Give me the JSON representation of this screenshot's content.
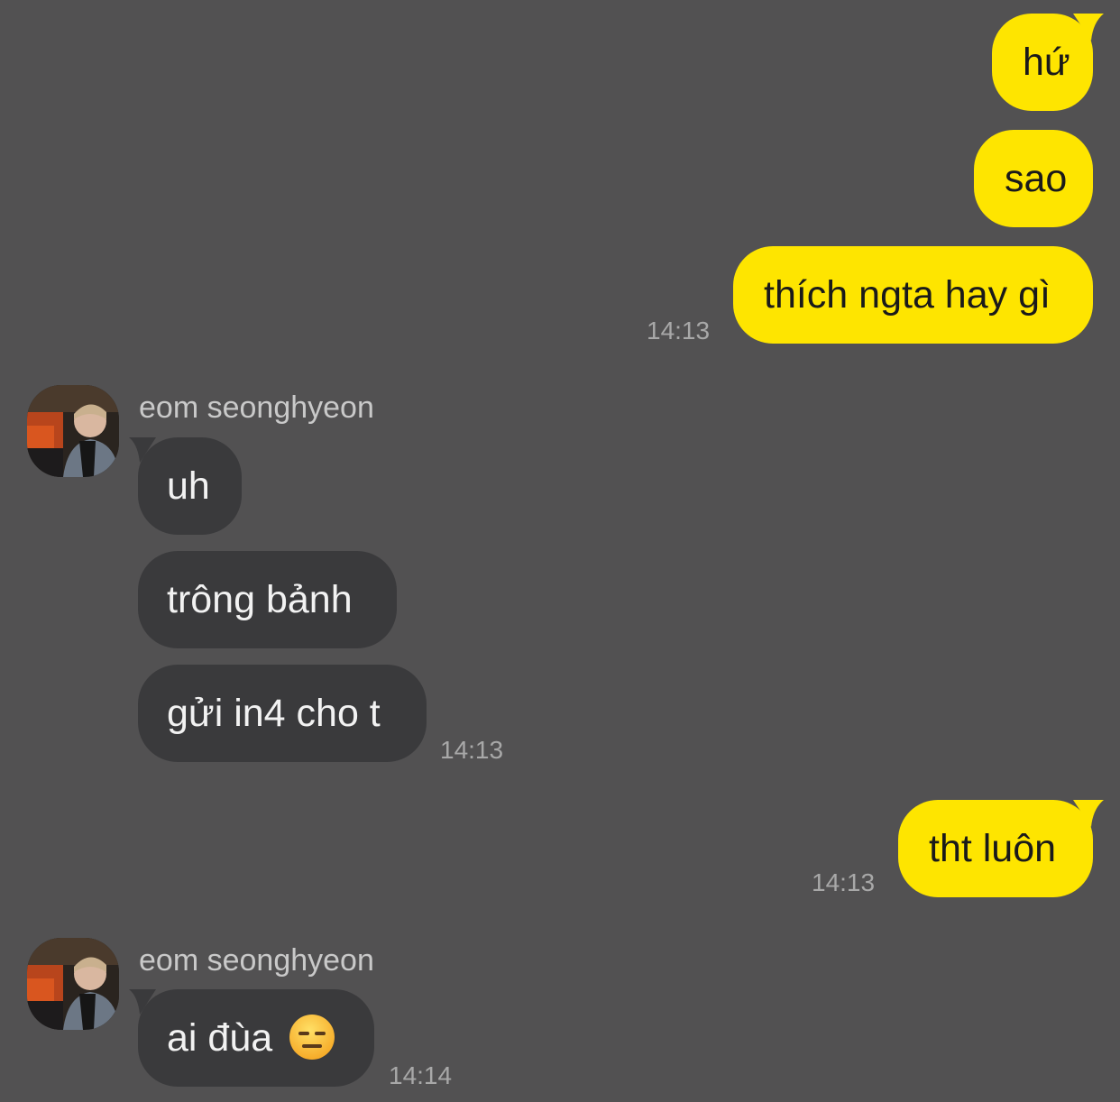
{
  "messages": [
    {
      "side": "me",
      "text": "hứ"
    },
    {
      "side": "me",
      "text": "sao"
    },
    {
      "side": "me",
      "text": "thích ngta hay gì",
      "time": "14:13"
    },
    {
      "side": "them",
      "sender": "eom seonghyeon",
      "text": "uh"
    },
    {
      "side": "them",
      "text": "trông bảnh"
    },
    {
      "side": "them",
      "text": "gửi in4 cho t",
      "time": "14:13"
    },
    {
      "side": "me",
      "text": "tht luôn",
      "time": "14:13"
    },
    {
      "side": "them",
      "sender": "eom seonghyeon",
      "text": "ai đùa",
      "emoji": "expressionless-face-emoji",
      "time": "14:14"
    }
  ],
  "colors": {
    "background": "#525152",
    "my_bubble": "#fee500",
    "their_bubble": "#3a3a3c",
    "timestamp": "#a8a8a8",
    "sender_name": "#c9c9c9"
  }
}
